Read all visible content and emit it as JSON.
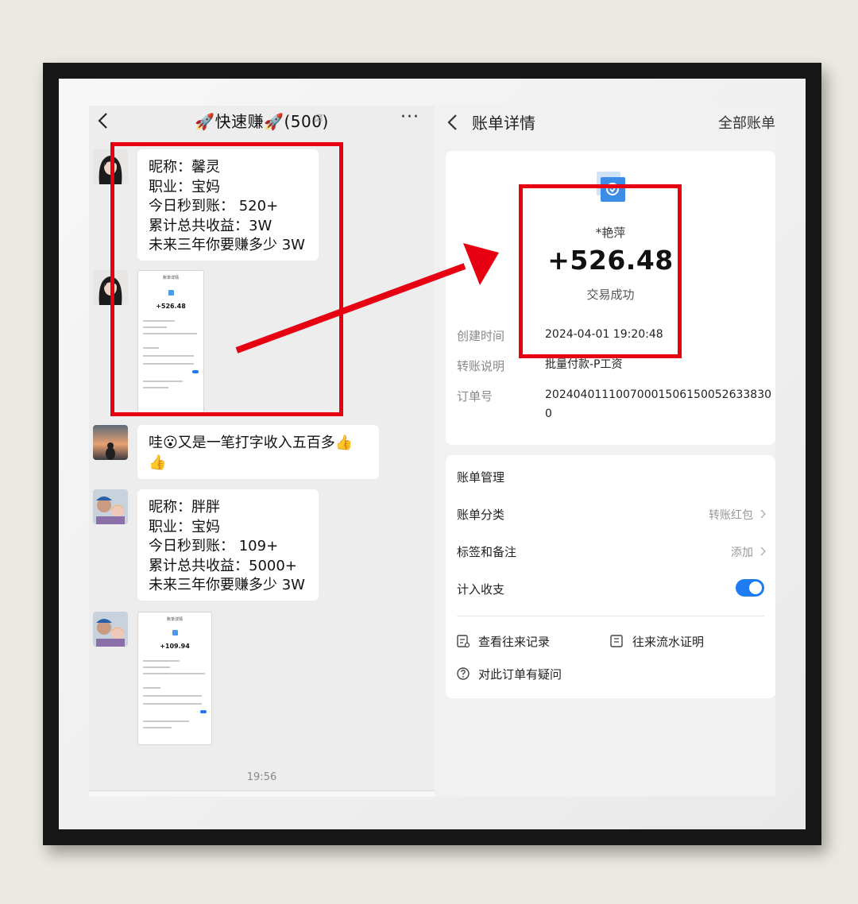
{
  "chat": {
    "title": "🚀快速赚🚀(500)",
    "more": "···",
    "messages": [
      {
        "lines": [
          "昵称：馨灵",
          "职业：宝妈",
          "今日秒到账： 520+",
          "累计总共收益：3W",
          "未来三年你要赚多少 3W"
        ]
      },
      {
        "thumb_title": "账单详情",
        "thumb_amount": "+526.48"
      },
      {
        "line1": "哇😮又是一笔打字收入五百多👍",
        "line2": "👍"
      },
      {
        "lines": [
          "昵称：胖胖",
          "职业：宝妈",
          "今日秒到账： 109+",
          "累计总共收益：5000+",
          "未来三年你要赚多少 3W"
        ]
      },
      {
        "thumb_title": "账单详情",
        "thumb_amount": "+109.94"
      }
    ],
    "time": "19:56"
  },
  "bill": {
    "title": "账单详情",
    "all_bills": "全部账单",
    "payer": "*艳萍",
    "amount": "+526.48",
    "status": "交易成功",
    "info": {
      "created_label": "创建时间",
      "created_value": "2024-04-01 19:20:48",
      "desc_label": "转账说明",
      "desc_value": "批量付款-P工资",
      "order_label": "订单号",
      "order_value_1": "20240401110070001506150052633830",
      "order_value_2": "0"
    },
    "management": {
      "title": "账单管理",
      "category_label": "账单分类",
      "category_value": "转账红包",
      "tags_label": "标签和备注",
      "tags_value": "添加",
      "count_label": "计入收支",
      "count_enabled": true
    },
    "links": {
      "records": "查看往来记录",
      "proof": "往来流水证明",
      "question": "对此订单有疑问"
    }
  },
  "colors": {
    "annotation_red": "#e60012",
    "accent_blue": "#1d7cf2"
  }
}
